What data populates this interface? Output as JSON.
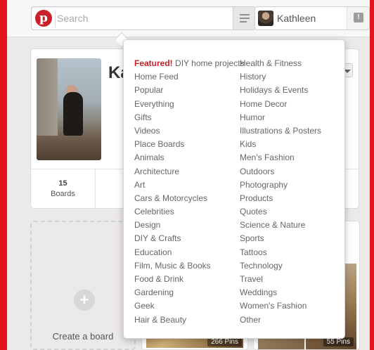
{
  "header": {
    "search_placeholder": "Search",
    "logo_glyph": "p",
    "user_name": "Kathleen",
    "notif_glyph": "!"
  },
  "profile": {
    "name": "Ka",
    "stats": [
      {
        "count": "15",
        "label": "Boards"
      }
    ]
  },
  "boards": {
    "create_label": "Create a board",
    "create_glyph": "+",
    "items": [
      {
        "pins": "266 Pins"
      },
      {
        "pins": "55 Pins"
      }
    ]
  },
  "dropdown": {
    "featured_prefix": "Featured!",
    "featured_text": "DIY home projects",
    "left_items": [
      "Home Feed",
      "Popular",
      "Everything",
      "Gifts",
      "Videos",
      "Place Boards",
      "Animals",
      "Architecture",
      "Art",
      "Cars & Motorcycles",
      "Celebrities",
      "Design",
      "DIY & Crafts",
      "Education",
      "Film, Music & Books",
      "Food & Drink",
      "Gardening",
      "Geek",
      "Hair & Beauty"
    ],
    "right_items": [
      "Health & Fitness",
      "History",
      "Holidays & Events",
      "Home Decor",
      "Humor",
      "Illustrations & Posters",
      "Kids",
      "Men's Fashion",
      "Outdoors",
      "Photography",
      "Products",
      "Quotes",
      "Science & Nature",
      "Sports",
      "Tattoos",
      "Technology",
      "Travel",
      "Weddings",
      "Women's Fashion",
      "Other"
    ]
  },
  "colors": {
    "brand_red": "#e4141c",
    "featured_red": "#cb2027"
  }
}
